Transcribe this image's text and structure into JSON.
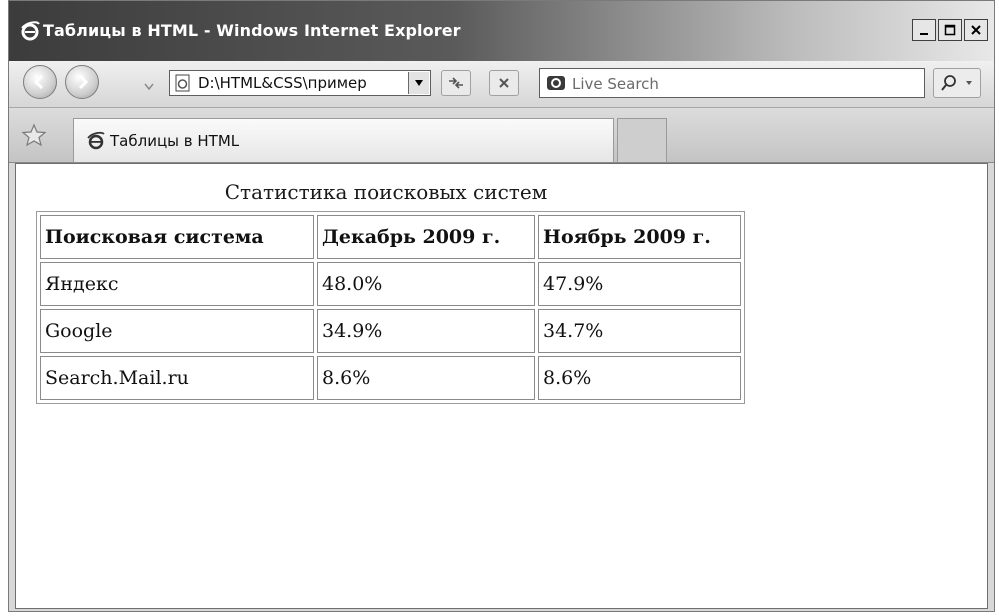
{
  "window": {
    "title": "Таблицы в HTML - Windows Internet Explorer"
  },
  "navbar": {
    "address": "D:\\HTML&CSS\\пример",
    "search_placeholder": "Live Search"
  },
  "tabs": [
    {
      "label": "Таблицы в HTML"
    }
  ],
  "page": {
    "table_caption": "Статистика поисковых систем",
    "headers": [
      "Поисковая система",
      "Декабрь 2009 г.",
      "Ноябрь 2009 г."
    ],
    "rows": [
      [
        "Яндекс",
        "48.0%",
        "47.9%"
      ],
      [
        "Google",
        "34.9%",
        "34.7%"
      ],
      [
        "Search.Mail.ru",
        "8.6%",
        "8.6%"
      ]
    ]
  },
  "icons": {
    "title": "ie-icon",
    "back": "back-arrow-icon",
    "forward": "forward-arrow-icon",
    "recent": "chevron-down-icon",
    "page": "page-icon",
    "dropdown": "dropdown-arrow-icon",
    "refresh": "refresh-icon",
    "stop": "stop-icon",
    "search_logo": "live-search-icon",
    "search_go": "magnifier-icon",
    "favorites": "star-icon",
    "tab": "ie-icon"
  }
}
